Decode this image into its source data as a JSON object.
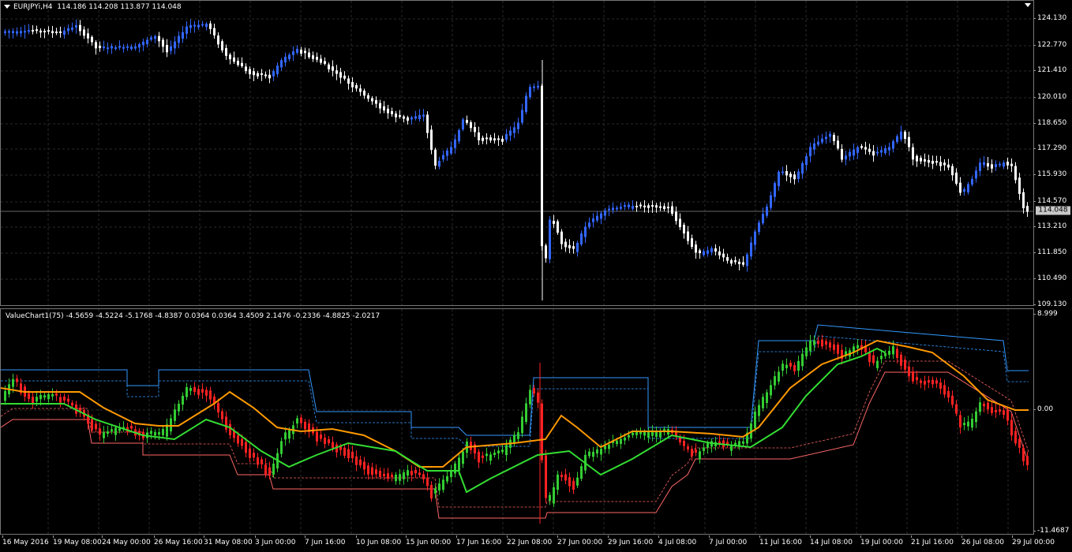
{
  "chart": {
    "symbol_line": "EURJPYi,H4",
    "ohlc": "114.186 114.208 113.877 114.048",
    "current_price": "114.048",
    "price_ticks": [
      "124.130",
      "122.770",
      "121.410",
      "120.010",
      "118.650",
      "117.290",
      "115.930",
      "114.570",
      "113.210",
      "111.850",
      "110.490",
      "109.130"
    ],
    "bull_color": "#3366ff",
    "bear_color": "#ffffff"
  },
  "indicator": {
    "header": "ValueChart1(75) -4.5659 -4.5224 -5.1768 -4.8387 0.0364 0.0364 3.4509 2.1476 -0.2336 -4.8825 -2.0217",
    "ticks": [
      "8.999",
      "0.00",
      "-11.4687"
    ],
    "up_color": "#33cc33",
    "down_color": "#ff2222",
    "line_fast_color": "#ff9900",
    "line_slow_color": "#33dd33",
    "upper_band_color": "#3399ff",
    "lower_band_color": "#ff6666"
  },
  "time_axis": [
    "16 May 2016",
    "19 May 08:00",
    "24 May 00:00",
    "26 May 16:00",
    "31 May 08:00",
    "3 Jun 00:00",
    "7 Jun 16:00",
    "10 Jun 08:00",
    "15 Jun 00:00",
    "17 Jun 16:00",
    "22 Jun 08:00",
    "27 Jun 00:00",
    "29 Jun 16:00",
    "4 Jul 08:00",
    "7 Jul 00:00",
    "11 Jul 16:00",
    "14 Jul 08:00",
    "19 Jul 00:00",
    "21 Jul 16:00",
    "26 Jul 08:00",
    "29 Jul 00:00"
  ]
}
